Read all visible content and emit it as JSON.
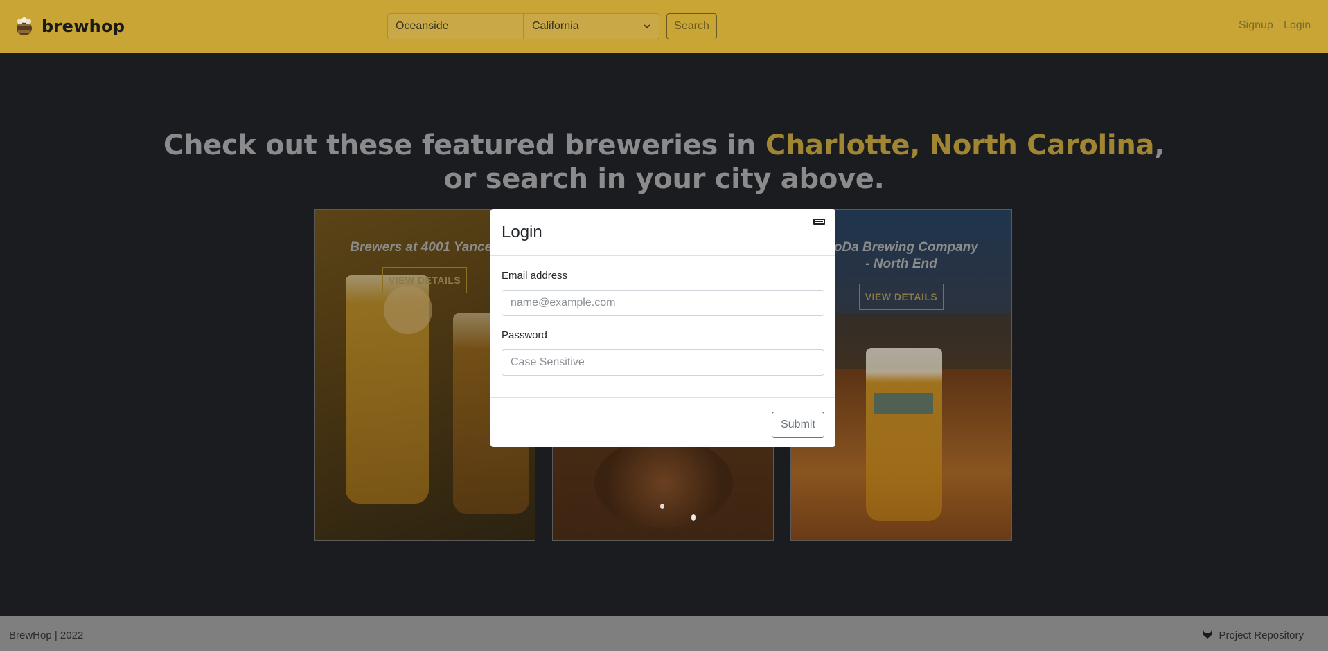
{
  "navbar": {
    "brand": "brewhop",
    "city_value": "Oceanside",
    "state_value": "California",
    "search_label": "Search",
    "signup_label": "Signup",
    "login_label": "Login"
  },
  "hero": {
    "prefix": "Check out these featured breweries in ",
    "location": "Charlotte, North Carolina",
    "suffix": ",",
    "line2": "or search in your city above."
  },
  "cards": [
    {
      "title": "Brewers at 4001 Yancey",
      "button": "VIEW DETAILS"
    },
    {
      "title": "",
      "button": ""
    },
    {
      "title_line1": "NoDa Brewing Company",
      "title_line2": "- North End",
      "button": "VIEW DETAILS"
    }
  ],
  "modal": {
    "title": "Login",
    "email_label": "Email address",
    "email_placeholder": "name@example.com",
    "password_label": "Password",
    "password_placeholder": "Case Sensitive",
    "submit_label": "Submit"
  },
  "footer": {
    "left_text": "BrewHop | 2022",
    "repo_link": "Project Repository"
  },
  "colors": {
    "navbar": "#c9a535",
    "background": "#1b1c20",
    "highlight": "#a08632",
    "footer": "#7f7f80"
  }
}
